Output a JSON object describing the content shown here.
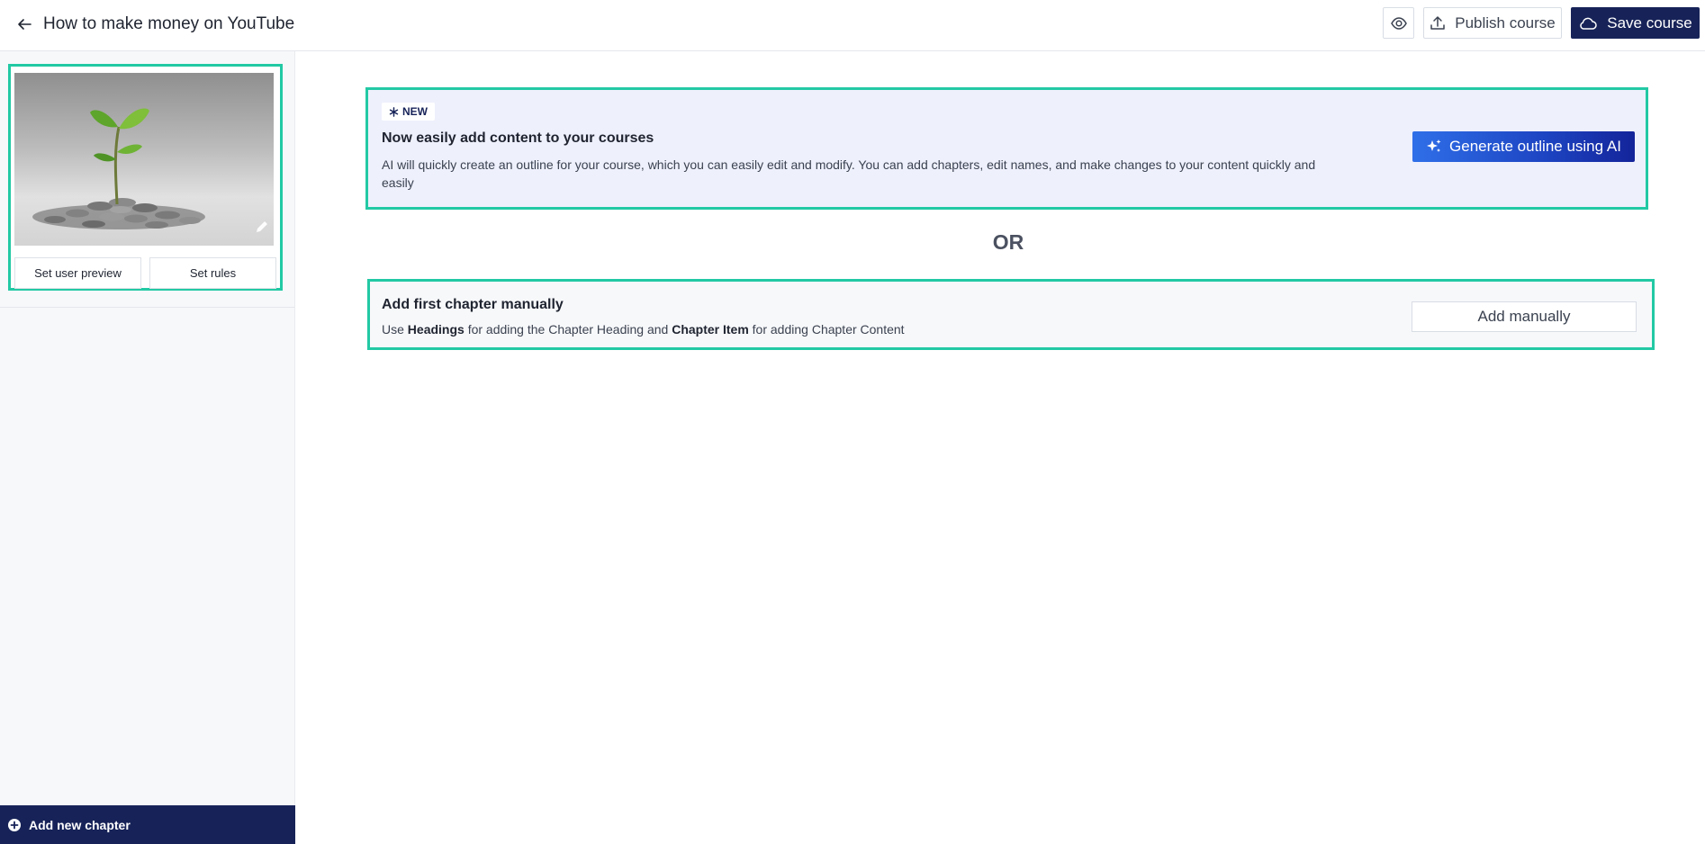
{
  "header": {
    "title": "How to make money on YouTube",
    "publish_label": "Publish course",
    "save_label": "Save course"
  },
  "sidebar": {
    "set_user_preview_label": "Set user preview",
    "set_rules_label": "Set rules",
    "add_chapter_label": "Add new chapter"
  },
  "ai_card": {
    "badge": "NEW",
    "title": "Now easily add content to your courses",
    "description": "AI will quickly create an outline for your course, which you can easily edit and modify. You can add chapters, edit names, and make changes to your content quickly and easily",
    "button_label": "Generate outline using AI"
  },
  "or_label": "OR",
  "manual_card": {
    "title": "Add first chapter manually",
    "desc_use": "Use",
    "desc_headings": "Headings",
    "desc_mid": "for adding the Chapter Heading and",
    "desc_chapter_item": "Chapter Item",
    "desc_end": "for adding Chapter Content",
    "button_label": "Add manually"
  },
  "colors": {
    "navy": "#172358",
    "accent_teal": "#22c9a4",
    "ai_card_bg": "#eef0fc"
  },
  "icons": [
    "arrow-left-icon",
    "eye-icon",
    "upload-icon",
    "cloud-icon",
    "pencil-icon",
    "plus-circle-icon",
    "sparkle-icon",
    "asterisk-icon"
  ]
}
